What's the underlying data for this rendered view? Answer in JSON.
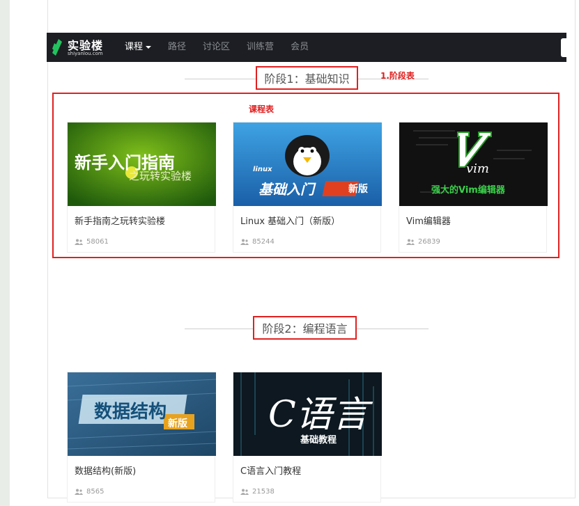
{
  "navbar": {
    "logo_text": "实验楼",
    "logo_sub": "shiyanlou.com",
    "items": [
      {
        "label": "课程"
      },
      {
        "label": "路径"
      },
      {
        "label": "讨论区"
      },
      {
        "label": "训练营"
      },
      {
        "label": "会员"
      }
    ]
  },
  "annotations": {
    "stage_table": "1.阶段表",
    "course_table": "课程表"
  },
  "colors": {
    "accent_red": "#e02020",
    "navbar_bg": "#1c1e23",
    "logo_green": "#22c35e"
  },
  "stages": [
    {
      "title": "阶段1：基础知识",
      "courses": [
        {
          "title": "新手指南之玩转实验楼",
          "students": "58061",
          "thumb_text": "新手入门指南",
          "thumb_sub": "之玩转实验楼",
          "thumb_icon": "intro-banner-icon"
        },
        {
          "title": "Linux 基础入门（新版）",
          "students": "85244",
          "thumb_text": "基础入门",
          "thumb_tag": "linux",
          "thumb_badge": "新版",
          "thumb_icon": "penguin-icon"
        },
        {
          "title": "Vim编辑器",
          "students": "26839",
          "thumb_text": "强大的Vim编辑器",
          "thumb_icon": "vim-logo-icon"
        }
      ]
    },
    {
      "title": "阶段2：编程语言",
      "courses": [
        {
          "title": "数据结构(新版)",
          "students": "8565",
          "thumb_text": "数据结构",
          "thumb_badge": "新版",
          "thumb_icon": "data-structure-banner-icon"
        },
        {
          "title": "C语言入门教程",
          "students": "21538",
          "thumb_text": "C语言",
          "thumb_sub": "基础教程",
          "thumb_icon": "c-language-banner-icon"
        }
      ]
    }
  ]
}
